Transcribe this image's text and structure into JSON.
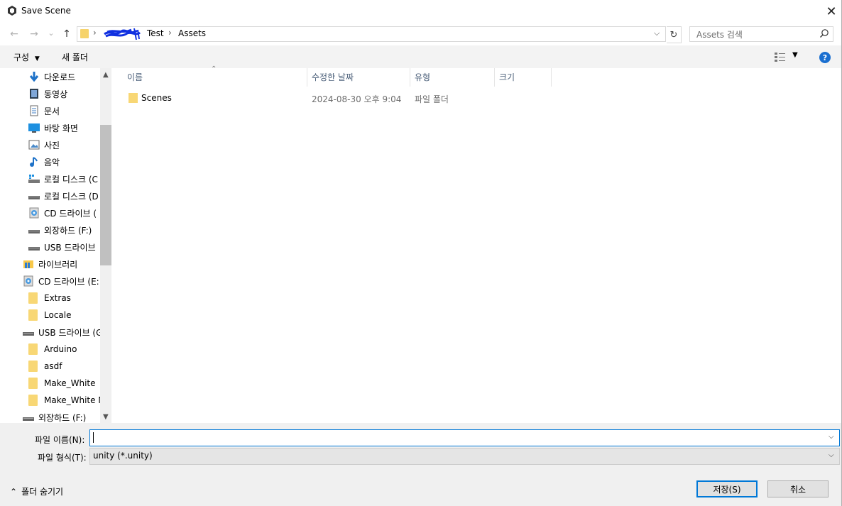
{
  "window": {
    "title": "Save Scene",
    "close_glyph": "✕"
  },
  "nav": {
    "back": "←",
    "forward": "→",
    "recent": "⌄",
    "up": "↑",
    "breadcrumb": [
      "Test",
      "Assets"
    ],
    "refresh": "↻",
    "search_placeholder": "Assets 검색"
  },
  "toolbar": {
    "organize": "구성",
    "new_folder": "새 폴더",
    "help": "?"
  },
  "sidebar": {
    "items": [
      {
        "label": "다운로드",
        "icon": "download-icon"
      },
      {
        "label": "동영상",
        "icon": "video-icon"
      },
      {
        "label": "문서",
        "icon": "document-icon"
      },
      {
        "label": "바탕 화면",
        "icon": "desktop-icon"
      },
      {
        "label": "사진",
        "icon": "picture-icon"
      },
      {
        "label": "음악",
        "icon": "music-icon"
      },
      {
        "label": "로컬 디스크 (C",
        "icon": "local-disk-icon"
      },
      {
        "label": "로컬 디스크 (D",
        "icon": "drive-icon"
      },
      {
        "label": "CD 드라이브 (",
        "icon": "cd-drive-icon"
      },
      {
        "label": "외장하드 (F:)",
        "icon": "drive-icon"
      },
      {
        "label": "USB 드라이브",
        "icon": "drive-icon"
      },
      {
        "label": "라이브러리",
        "icon": "library-icon"
      },
      {
        "label": "CD 드라이브 (E:",
        "icon": "cd-drive-icon"
      },
      {
        "label": "Extras",
        "icon": "folder-icon"
      },
      {
        "label": "Locale",
        "icon": "folder-icon"
      },
      {
        "label": "USB 드라이브 (G",
        "icon": "drive-icon"
      },
      {
        "label": "Arduino",
        "icon": "folder-icon"
      },
      {
        "label": "asdf",
        "icon": "folder-icon"
      },
      {
        "label": "Make_White",
        "icon": "folder-icon"
      },
      {
        "label": "Make_White N",
        "icon": "folder-icon"
      },
      {
        "label": "외장하드 (F:)",
        "icon": "drive-icon"
      }
    ]
  },
  "columns": [
    "이름",
    "수정한 날짜",
    "유형",
    "크기"
  ],
  "files": [
    {
      "name": "Scenes",
      "date": "2024-08-30 오후 9:04",
      "type": "파일 폴더",
      "size": ""
    }
  ],
  "form": {
    "filename_label": "파일 이름(N):",
    "filename_value": "",
    "filetype_label": "파일 형식(T):",
    "filetype_value": "unity (*.unity)",
    "hide_folders": "폴더 숨기기",
    "save": "저장(S)",
    "cancel": "취소"
  },
  "colors": {
    "accent": "#0078d7",
    "folder": "#f8d775",
    "help": "#1a6fd0"
  }
}
